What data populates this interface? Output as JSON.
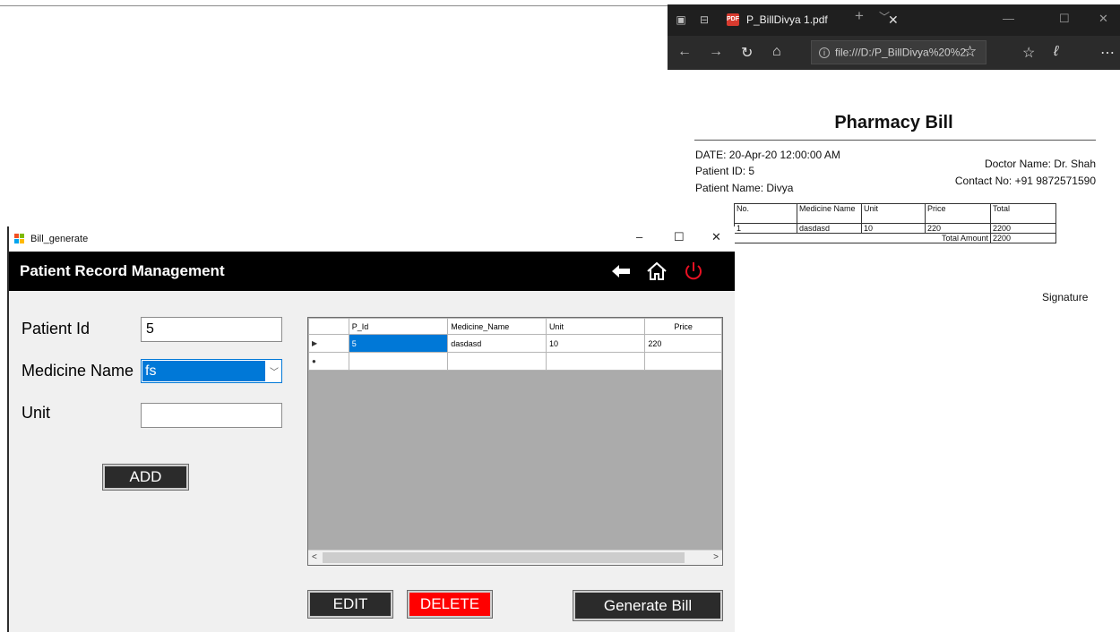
{
  "pdf_viewer": {
    "tab_title": "P_BillDivya 1.pdf",
    "tab_close": "✕",
    "tab_new": "+",
    "address": "file:///D:/P_BillDivya%20%2",
    "bill": {
      "title": "Pharmacy Bill",
      "date": "DATE: 20-Apr-20 12:00:00 AM",
      "patient_id": "Patient ID: 5",
      "patient_name": "Patient Name: Divya",
      "doctor": "Doctor Name: Dr. Shah",
      "contact": "Contact No: +91 9872571590",
      "columns": [
        "No.",
        "Medicine Name",
        "Unit",
        "Price",
        "Total"
      ],
      "rows": [
        [
          "1",
          "dasdasd",
          "10",
          "220",
          "2200"
        ]
      ],
      "total_label": "Total Amount",
      "total_value": "2200",
      "signature": "Signature"
    }
  },
  "app": {
    "window_title": "Bill_generate",
    "header_title": "Patient Record Management",
    "form": {
      "patient_id_label": "Patient Id",
      "patient_id_value": "5",
      "medicine_label": "Medicine Name",
      "medicine_value": "fs",
      "unit_label": "Unit",
      "unit_value": "",
      "add_label": "ADD"
    },
    "grid": {
      "columns": [
        "P_Id",
        "Medicine_Name",
        "Unit",
        "Price"
      ],
      "rows": [
        [
          "5",
          "dasdasd",
          "10",
          "220"
        ]
      ]
    },
    "buttons": {
      "edit": "EDIT",
      "delete": "DELETE",
      "generate": "Generate Bill"
    },
    "colors": {
      "header_bg": "#000000",
      "delete_bg": "#ff0000",
      "selection": "#0078d7",
      "power_icon": "#e81123"
    }
  }
}
